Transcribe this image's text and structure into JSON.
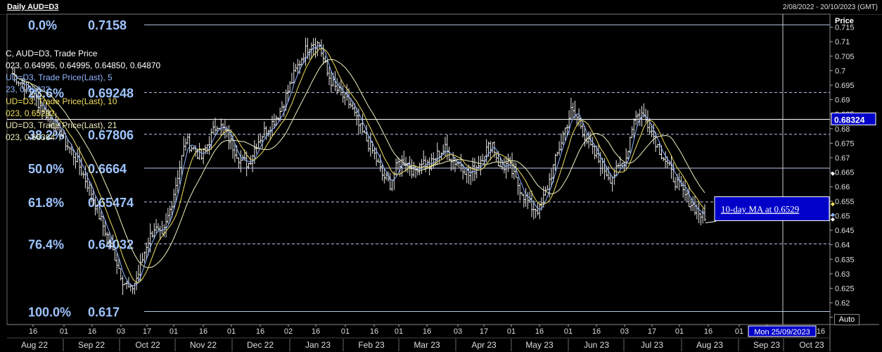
{
  "header": {
    "title": "Daily AUD=D3",
    "date_range": "2/08/2022 - 20/10/2023 (GMT)"
  },
  "legend": {
    "lines": [
      {
        "text": "C, AUD=D3, Trade Price",
        "color": "#ffffff"
      },
      {
        "text": "023, 0.64995, 0.64995, 0.64850, 0.64870",
        "color": "#ffffff"
      },
      {
        "text": "UD=D3, Trade Price(Last),  5",
        "color": "#8fb4ff"
      },
      {
        "text": "23, 0.65032",
        "color": "#8fb4ff"
      },
      {
        "text": "UD=D3, Trade Price(Last),  10",
        "color": "#f0e060"
      },
      {
        "text": "023, 0.65292",
        "color": "#f0e060"
      },
      {
        "text": "UD=D3, Trade Price(Last),  21",
        "color": "#f0f0c0"
      },
      {
        "text": "023, 0.66364",
        "color": "#f0f0c0"
      }
    ]
  },
  "controls": {
    "auto_label": "Auto"
  },
  "colors": {
    "fib_text": "#9ec4ff",
    "annotation_bg": "#0000c8",
    "price_box_bg": "#0000c8",
    "grid": "#b8c8e8",
    "candles": "#e6e6e6"
  },
  "chart_data": {
    "type": "line",
    "title": "Daily AUD=D3",
    "ylabel": "Price",
    "ylim": [
      0.6125,
      0.7195
    ],
    "y_ticks": [
      0.715,
      0.71,
      0.705,
      0.7,
      0.695,
      0.69,
      0.685,
      0.68,
      0.675,
      0.67,
      0.665,
      0.66,
      0.655,
      0.65,
      0.645,
      0.64,
      0.635,
      0.63,
      0.625,
      0.62,
      0.615
    ],
    "y_tick_labels": [
      "0.715",
      "0.71",
      "0.705",
      "0.7",
      "0.695",
      "0.69",
      "0.685",
      "0.68",
      "0.675",
      "0.67",
      "0.665",
      "0.66",
      "0.655",
      "0.65",
      "0.645",
      "0.64",
      "0.635",
      "0.63",
      "0.625",
      "0.62",
      "0.615"
    ],
    "x_day_ticks": [
      "16",
      "01",
      "16",
      "03",
      "17",
      "01",
      "16",
      "01",
      "16",
      "02",
      "16",
      "01",
      "16",
      "01",
      "16",
      "03",
      "17",
      "01",
      "16",
      "01",
      "16",
      "03",
      "17",
      "01",
      "16",
      "01",
      "16"
    ],
    "x_month_labels": [
      "Aug 22",
      "Sep 22",
      "Oct 22",
      "Nov 22",
      "Dec 22",
      "Jan 23",
      "Feb 23",
      "Mar 23",
      "Apr 23",
      "May 23",
      "Jun 23",
      "Jul 23",
      "Aug 23",
      "Sep 23",
      "Oct 23"
    ],
    "fib_levels": [
      {
        "pct": "0.0%",
        "label": "0.7158",
        "value": 0.7158
      },
      {
        "pct": "23.6%",
        "label": "0.69248",
        "value": 0.69248
      },
      {
        "pct": "38.2%",
        "label": "0.67806",
        "value": 0.67806
      },
      {
        "pct": "50.0%",
        "label": "0.6664",
        "value": 0.6664
      },
      {
        "pct": "61.8%",
        "label": "0.65474",
        "value": 0.65474
      },
      {
        "pct": "76.4%",
        "label": "0.64032",
        "value": 0.64032
      },
      {
        "pct": "100.0%",
        "label": "0.617",
        "value": 0.617
      }
    ],
    "horizontal_line": {
      "value": 0.68324,
      "label": "0.68324"
    },
    "annotation": {
      "text": "10-day MA at 0.6529",
      "value": 0.6529
    },
    "crosshair_date_label": "Mon 25/09/2023",
    "price_series_approx": [
      [
        0,
        0.699
      ],
      [
        4,
        0.696
      ],
      [
        8,
        0.694
      ],
      [
        12,
        0.69
      ],
      [
        16,
        0.686
      ],
      [
        20,
        0.683
      ],
      [
        24,
        0.679
      ],
      [
        28,
        0.674
      ],
      [
        32,
        0.67
      ],
      [
        36,
        0.664
      ],
      [
        40,
        0.658
      ],
      [
        44,
        0.65
      ],
      [
        48,
        0.643
      ],
      [
        52,
        0.636
      ],
      [
        56,
        0.628
      ],
      [
        60,
        0.624
      ],
      [
        64,
        0.63
      ],
      [
        68,
        0.64
      ],
      [
        72,
        0.646
      ],
      [
        76,
        0.642
      ],
      [
        80,
        0.652
      ],
      [
        84,
        0.664
      ],
      [
        88,
        0.676
      ],
      [
        92,
        0.673
      ],
      [
        96,
        0.67
      ],
      [
        100,
        0.676
      ],
      [
        104,
        0.682
      ],
      [
        108,
        0.679
      ],
      [
        112,
        0.674
      ],
      [
        116,
        0.669
      ],
      [
        120,
        0.668
      ],
      [
        124,
        0.675
      ],
      [
        128,
        0.679
      ],
      [
        132,
        0.682
      ],
      [
        136,
        0.686
      ],
      [
        140,
        0.693
      ],
      [
        144,
        0.7
      ],
      [
        148,
        0.706
      ],
      [
        152,
        0.71
      ],
      [
        156,
        0.709
      ],
      [
        160,
        0.699
      ],
      [
        164,
        0.694
      ],
      [
        168,
        0.691
      ],
      [
        172,
        0.688
      ],
      [
        176,
        0.681
      ],
      [
        180,
        0.676
      ],
      [
        184,
        0.671
      ],
      [
        188,
        0.664
      ],
      [
        192,
        0.661
      ],
      [
        196,
        0.668
      ],
      [
        200,
        0.669
      ],
      [
        204,
        0.665
      ],
      [
        208,
        0.669
      ],
      [
        212,
        0.667
      ],
      [
        216,
        0.671
      ],
      [
        220,
        0.673
      ],
      [
        224,
        0.669
      ],
      [
        228,
        0.668
      ],
      [
        232,
        0.664
      ],
      [
        236,
        0.667
      ],
      [
        240,
        0.672
      ],
      [
        244,
        0.675
      ],
      [
        248,
        0.666
      ],
      [
        252,
        0.668
      ],
      [
        256,
        0.662
      ],
      [
        260,
        0.657
      ],
      [
        264,
        0.653
      ],
      [
        268,
        0.652
      ],
      [
        272,
        0.66
      ],
      [
        276,
        0.669
      ],
      [
        280,
        0.678
      ],
      [
        284,
        0.686
      ],
      [
        288,
        0.683
      ],
      [
        292,
        0.676
      ],
      [
        296,
        0.671
      ],
      [
        300,
        0.667
      ],
      [
        304,
        0.663
      ],
      [
        308,
        0.666
      ],
      [
        312,
        0.67
      ],
      [
        316,
        0.684
      ],
      [
        320,
        0.685
      ],
      [
        324,
        0.681
      ],
      [
        328,
        0.674
      ],
      [
        332,
        0.669
      ],
      [
        336,
        0.663
      ],
      [
        340,
        0.659
      ],
      [
        344,
        0.655
      ],
      [
        348,
        0.652
      ],
      [
        352,
        0.6487
      ]
    ],
    "ma5_last": 0.65032,
    "ma10_last": 0.65292,
    "ma21_last": 0.66364
  }
}
